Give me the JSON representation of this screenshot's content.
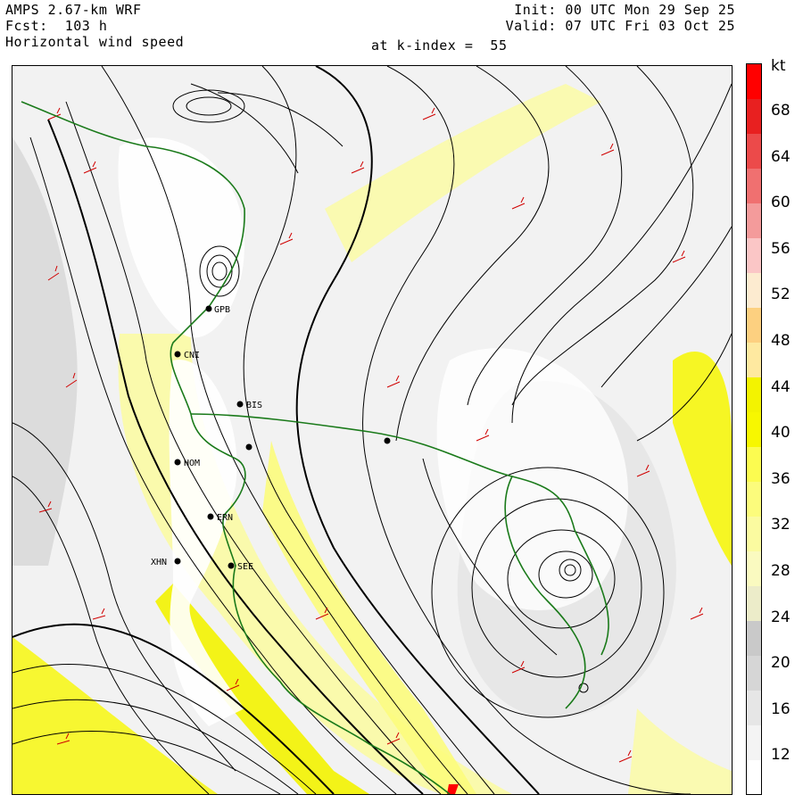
{
  "header": {
    "model": "AMPS 2.67-km WRF",
    "forecast": "Fcst:  103 h",
    "field": "Horizontal wind speed",
    "init": "Init: 00 UTC Mon 29 Sep 25",
    "valid": "Valid: 07 UTC Fri 03 Oct 25",
    "level": "at k-index =  55"
  },
  "colorbar": {
    "unit": "kt",
    "ticks": [
      "68",
      "64",
      "60",
      "56",
      "52",
      "48",
      "44",
      "40",
      "36",
      "32",
      "28",
      "24",
      "20",
      "16",
      "12"
    ],
    "colors": [
      "#ffffff",
      "#f4f4f4",
      "#e6e6e6",
      "#d6d6d6",
      "#c9c9c9",
      "#ececc9",
      "#fafac0",
      "#fbfba0",
      "#fcfc7c",
      "#fcfc50",
      "#f7f700",
      "#f3f300",
      "#fee9a0",
      "#fdd080",
      "#fdebd0",
      "#fbc6c6",
      "#f49b9b",
      "#f07070",
      "#ec4a4a",
      "#e82020",
      "#ff0000"
    ]
  },
  "stations": [
    "BIS",
    "HOM",
    "ERN",
    "XHN",
    "SEE",
    "GPB",
    "CNI"
  ]
}
